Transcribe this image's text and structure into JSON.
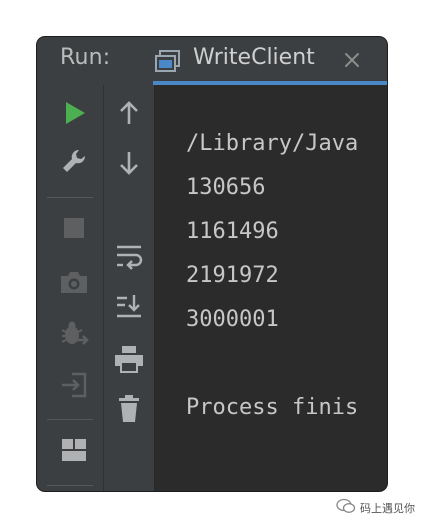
{
  "header": {
    "run_label": "Run:",
    "tab_title": "WriteClient"
  },
  "left_toolbar": {
    "items": [
      {
        "icon": "play-icon",
        "enabled": true
      },
      {
        "icon": "wrench-icon",
        "enabled": true
      },
      {
        "icon": "stop-icon",
        "enabled": false
      },
      {
        "icon": "camera-icon",
        "enabled": false
      },
      {
        "icon": "debug-icon",
        "enabled": false
      },
      {
        "icon": "login-icon",
        "enabled": false
      },
      {
        "icon": "layout-icon",
        "enabled": true
      }
    ]
  },
  "mid_toolbar": {
    "items": [
      {
        "icon": "arrow-up-icon"
      },
      {
        "icon": "arrow-down-icon"
      },
      {
        "icon": "soft-wrap-icon"
      },
      {
        "icon": "scroll-to-end-icon"
      },
      {
        "icon": "print-icon"
      },
      {
        "icon": "trash-icon"
      }
    ]
  },
  "console": {
    "lines": [
      "/Library/Java",
      "130656",
      "1161496",
      "2191972",
      "3000001",
      "",
      "Process finis"
    ]
  },
  "watermark": {
    "text": "码上遇见你"
  },
  "colors": {
    "header_bg": "#3c3f41",
    "console_bg": "#2b2b2b",
    "run_green": "#4caf50",
    "tab_underline": "#4a88c7",
    "text": "#c7c7c7"
  }
}
